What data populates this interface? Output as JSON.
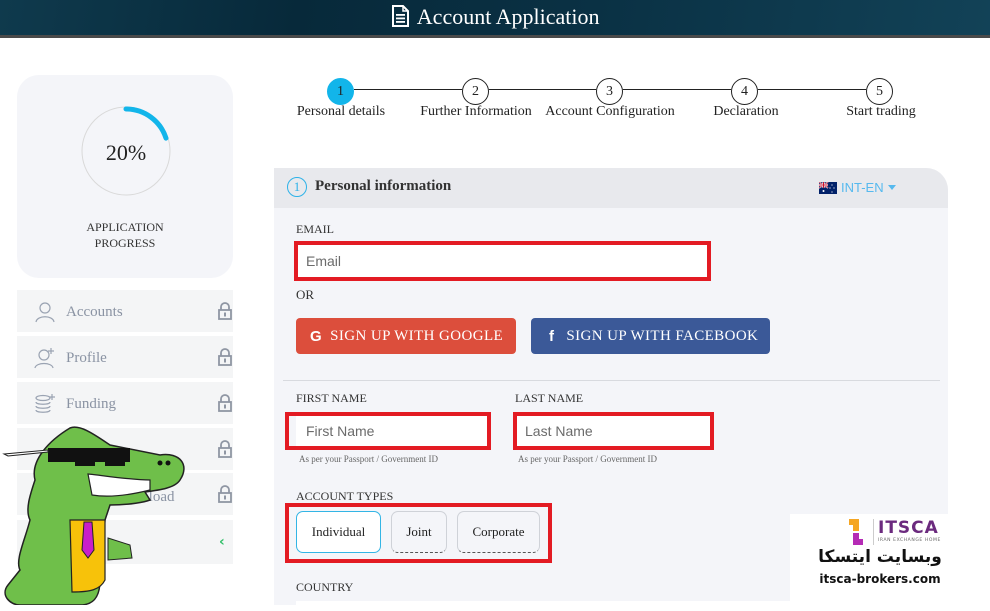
{
  "header": {
    "title": "Account Application",
    "icon": "document-icon"
  },
  "progress": {
    "value_percent": 20,
    "display": "20%",
    "label_line1": "APPLICATION",
    "label_line2": "PROGRESS",
    "color": "#12b5ea"
  },
  "sidebar": {
    "items": [
      {
        "label": "Accounts",
        "icon": "user-icon",
        "locked": true
      },
      {
        "label": "Profile",
        "icon": "user-plus-icon",
        "locked": true
      },
      {
        "label": "Funding",
        "icon": "coins-icon",
        "locked": true
      },
      {
        "label": "",
        "icon": "unknown-icon",
        "locked": true
      },
      {
        "label": "Download",
        "icon": "download-icon",
        "locked": true
      }
    ],
    "collapse_glyph": "‹"
  },
  "steps": [
    {
      "number": "1",
      "label": "Personal details",
      "active": true
    },
    {
      "number": "2",
      "label": "Further Information",
      "active": false
    },
    {
      "number": "3",
      "label": "Account Configuration",
      "active": false
    },
    {
      "number": "4",
      "label": "Declaration",
      "active": false
    },
    {
      "number": "5",
      "label": "Start trading",
      "active": false
    }
  ],
  "panel": {
    "step_number": "1",
    "title": "Personal information",
    "language": {
      "selected": "INT-EN",
      "flag": "australia-flag"
    }
  },
  "form": {
    "email": {
      "label": "EMAIL",
      "placeholder": "Email",
      "value": ""
    },
    "or_text": "OR",
    "google_button": {
      "icon": "G",
      "label": "SIGN UP WITH GOOGLE",
      "color": "#dc4e3c"
    },
    "facebook_button": {
      "icon": "f",
      "label": "SIGN UP WITH FACEBOOK",
      "color": "#3b5998"
    },
    "first_name": {
      "label": "FIRST NAME",
      "placeholder": "First Name",
      "value": "",
      "hint": "As per your Passport / Government ID"
    },
    "last_name": {
      "label": "LAST NAME",
      "placeholder": "Last Name",
      "value": "",
      "hint": "As per your Passport / Government ID"
    },
    "account_types": {
      "label": "ACCOUNT TYPES",
      "options": [
        "Individual",
        "Joint",
        "Corporate"
      ],
      "selected": "Individual"
    },
    "country": {
      "label": "COUNTRY"
    }
  },
  "watermark": {
    "brand": "ITSCA",
    "tagline": "IRAN EXCHANGE HOME",
    "persian_text": "وبسایت ایتسکا",
    "url": "itsca-brokers.com"
  },
  "highlight_color": "#e31b23"
}
